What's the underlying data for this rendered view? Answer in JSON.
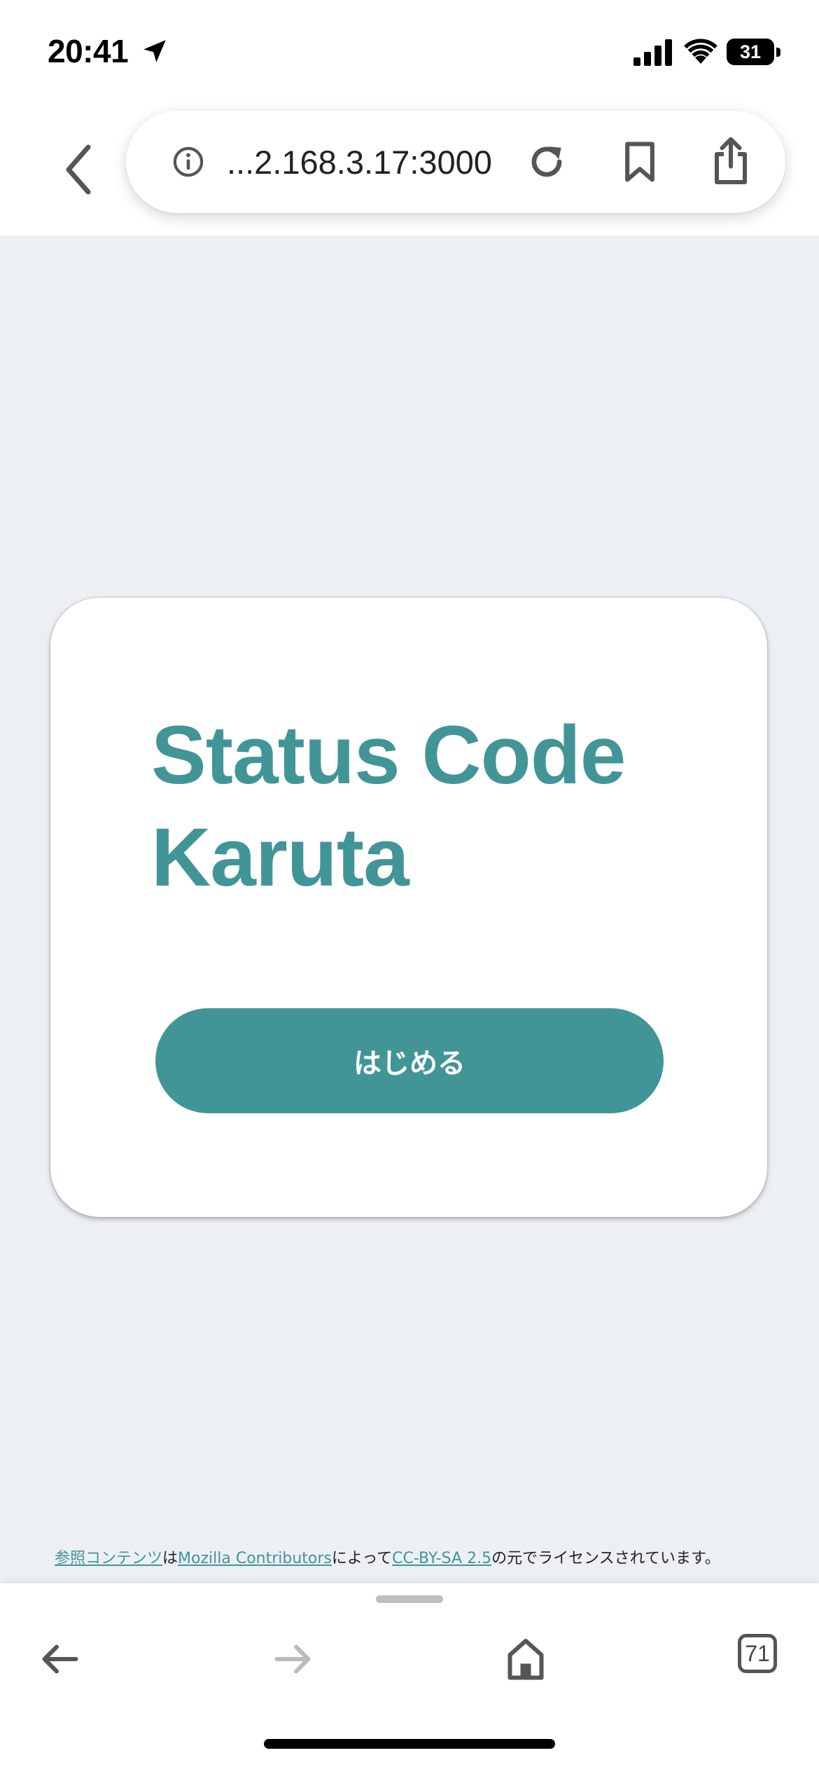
{
  "status_bar": {
    "time": "20:41",
    "battery": "31"
  },
  "browser": {
    "url": "...2.168.3.17:3000",
    "tab_count": "71"
  },
  "card": {
    "title": "Status Code Karuta",
    "start_button_label": "はじめる"
  },
  "footer": {
    "ref_link": "参照コンテンツ",
    "text_wa": "は",
    "contributors_link": "Mozilla Contributors",
    "text_by": "によって",
    "license_link": "CC-BY-SA 2.5",
    "text_tail": "の元でライセンスされています。"
  },
  "colors": {
    "accent": "#429596",
    "page_background": "#ecf0f5"
  },
  "icons": [
    "location-arrow-icon",
    "cellular-signal-icon",
    "wifi-icon",
    "battery-icon",
    "back-chevron-icon",
    "info-icon",
    "reload-icon",
    "bookmark-icon",
    "share-icon",
    "arrow-left-icon",
    "arrow-right-icon",
    "home-icon",
    "tabs-icon"
  ]
}
